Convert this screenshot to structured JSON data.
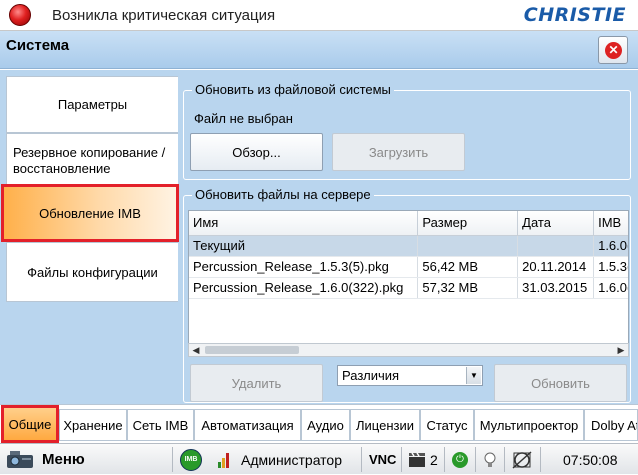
{
  "title_bar": {
    "text": "Возникла критическая ситуация",
    "logo": "CHRISTIE"
  },
  "header": {
    "title": "Система"
  },
  "nav": {
    "items": [
      {
        "label": "Параметры"
      },
      {
        "label": "Резервное копирование / восстановление"
      },
      {
        "label": "Обновление IMB",
        "active": true
      },
      {
        "label": "Файлы конфигурации"
      }
    ]
  },
  "fs_update": {
    "legend": "Обновить из файловой системы",
    "file_status": "Файл не выбран",
    "browse_label": "Обзор...",
    "upload_label": "Загрузить"
  },
  "server_update": {
    "legend": "Обновить файлы на сервере",
    "columns": [
      "Имя",
      "Размер",
      "Дата",
      "IMB"
    ],
    "rows": [
      {
        "name": "Текущий",
        "size": "",
        "date": "",
        "imb": "1.6.0(",
        "current": true
      },
      {
        "name": "Percussion_Release_1.5.3(5).pkg",
        "size": "56,42 MB",
        "date": "20.11.2014",
        "imb": "1.5.3("
      },
      {
        "name": "Percussion_Release_1.6.0(322).pkg",
        "size": "57,32 MB",
        "date": "31.03.2015",
        "imb": "1.6.0("
      }
    ],
    "delete_label": "Удалить",
    "filter_value": "Различия",
    "refresh_label": "Обновить"
  },
  "tabs": [
    {
      "label": "Общие",
      "active": true
    },
    {
      "label": "Хранение"
    },
    {
      "label": "Сеть IMB"
    },
    {
      "label": "Автоматизация"
    },
    {
      "label": "Аудио"
    },
    {
      "label": "Лицензии"
    },
    {
      "label": "Статус"
    },
    {
      "label": "Мультипроектор"
    },
    {
      "label": "Dolby At"
    }
  ],
  "status_bar": {
    "menu_label": "Меню",
    "imb_badge": "IMB",
    "user": "Администратор",
    "vnc": "VNC",
    "sessions": "2",
    "time": "07:50:08"
  },
  "colors": {
    "panel_bg": "#b9d5ee",
    "header_bg": "#a9cbeb",
    "highlight": "#e3202a",
    "active_tab": "#ffa940"
  }
}
